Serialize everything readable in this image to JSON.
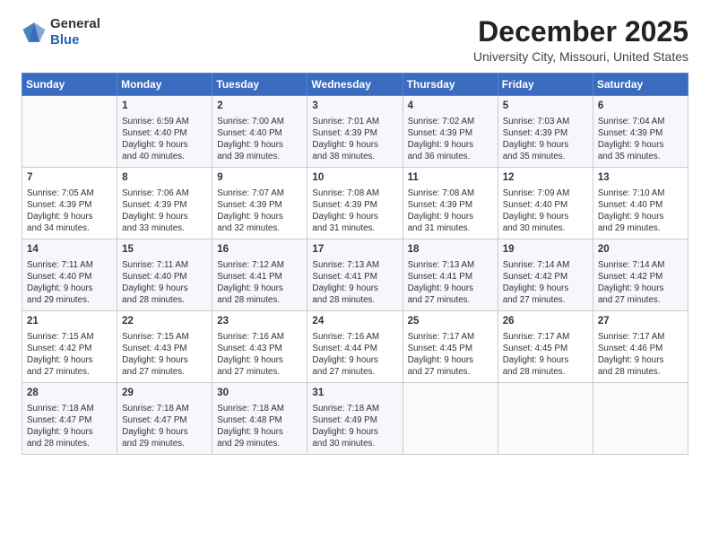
{
  "logo": {
    "general": "General",
    "blue": "Blue"
  },
  "header": {
    "title": "December 2025",
    "subtitle": "University City, Missouri, United States"
  },
  "days_of_week": [
    "Sunday",
    "Monday",
    "Tuesday",
    "Wednesday",
    "Thursday",
    "Friday",
    "Saturday"
  ],
  "weeks": [
    [
      {
        "num": "",
        "info": ""
      },
      {
        "num": "1",
        "info": "Sunrise: 6:59 AM\nSunset: 4:40 PM\nDaylight: 9 hours\nand 40 minutes."
      },
      {
        "num": "2",
        "info": "Sunrise: 7:00 AM\nSunset: 4:40 PM\nDaylight: 9 hours\nand 39 minutes."
      },
      {
        "num": "3",
        "info": "Sunrise: 7:01 AM\nSunset: 4:39 PM\nDaylight: 9 hours\nand 38 minutes."
      },
      {
        "num": "4",
        "info": "Sunrise: 7:02 AM\nSunset: 4:39 PM\nDaylight: 9 hours\nand 36 minutes."
      },
      {
        "num": "5",
        "info": "Sunrise: 7:03 AM\nSunset: 4:39 PM\nDaylight: 9 hours\nand 35 minutes."
      },
      {
        "num": "6",
        "info": "Sunrise: 7:04 AM\nSunset: 4:39 PM\nDaylight: 9 hours\nand 35 minutes."
      }
    ],
    [
      {
        "num": "7",
        "info": "Sunrise: 7:05 AM\nSunset: 4:39 PM\nDaylight: 9 hours\nand 34 minutes."
      },
      {
        "num": "8",
        "info": "Sunrise: 7:06 AM\nSunset: 4:39 PM\nDaylight: 9 hours\nand 33 minutes."
      },
      {
        "num": "9",
        "info": "Sunrise: 7:07 AM\nSunset: 4:39 PM\nDaylight: 9 hours\nand 32 minutes."
      },
      {
        "num": "10",
        "info": "Sunrise: 7:08 AM\nSunset: 4:39 PM\nDaylight: 9 hours\nand 31 minutes."
      },
      {
        "num": "11",
        "info": "Sunrise: 7:08 AM\nSunset: 4:39 PM\nDaylight: 9 hours\nand 31 minutes."
      },
      {
        "num": "12",
        "info": "Sunrise: 7:09 AM\nSunset: 4:40 PM\nDaylight: 9 hours\nand 30 minutes."
      },
      {
        "num": "13",
        "info": "Sunrise: 7:10 AM\nSunset: 4:40 PM\nDaylight: 9 hours\nand 29 minutes."
      }
    ],
    [
      {
        "num": "14",
        "info": "Sunrise: 7:11 AM\nSunset: 4:40 PM\nDaylight: 9 hours\nand 29 minutes."
      },
      {
        "num": "15",
        "info": "Sunrise: 7:11 AM\nSunset: 4:40 PM\nDaylight: 9 hours\nand 28 minutes."
      },
      {
        "num": "16",
        "info": "Sunrise: 7:12 AM\nSunset: 4:41 PM\nDaylight: 9 hours\nand 28 minutes."
      },
      {
        "num": "17",
        "info": "Sunrise: 7:13 AM\nSunset: 4:41 PM\nDaylight: 9 hours\nand 28 minutes."
      },
      {
        "num": "18",
        "info": "Sunrise: 7:13 AM\nSunset: 4:41 PM\nDaylight: 9 hours\nand 27 minutes."
      },
      {
        "num": "19",
        "info": "Sunrise: 7:14 AM\nSunset: 4:42 PM\nDaylight: 9 hours\nand 27 minutes."
      },
      {
        "num": "20",
        "info": "Sunrise: 7:14 AM\nSunset: 4:42 PM\nDaylight: 9 hours\nand 27 minutes."
      }
    ],
    [
      {
        "num": "21",
        "info": "Sunrise: 7:15 AM\nSunset: 4:42 PM\nDaylight: 9 hours\nand 27 minutes."
      },
      {
        "num": "22",
        "info": "Sunrise: 7:15 AM\nSunset: 4:43 PM\nDaylight: 9 hours\nand 27 minutes."
      },
      {
        "num": "23",
        "info": "Sunrise: 7:16 AM\nSunset: 4:43 PM\nDaylight: 9 hours\nand 27 minutes."
      },
      {
        "num": "24",
        "info": "Sunrise: 7:16 AM\nSunset: 4:44 PM\nDaylight: 9 hours\nand 27 minutes."
      },
      {
        "num": "25",
        "info": "Sunrise: 7:17 AM\nSunset: 4:45 PM\nDaylight: 9 hours\nand 27 minutes."
      },
      {
        "num": "26",
        "info": "Sunrise: 7:17 AM\nSunset: 4:45 PM\nDaylight: 9 hours\nand 28 minutes."
      },
      {
        "num": "27",
        "info": "Sunrise: 7:17 AM\nSunset: 4:46 PM\nDaylight: 9 hours\nand 28 minutes."
      }
    ],
    [
      {
        "num": "28",
        "info": "Sunrise: 7:18 AM\nSunset: 4:47 PM\nDaylight: 9 hours\nand 28 minutes."
      },
      {
        "num": "29",
        "info": "Sunrise: 7:18 AM\nSunset: 4:47 PM\nDaylight: 9 hours\nand 29 minutes."
      },
      {
        "num": "30",
        "info": "Sunrise: 7:18 AM\nSunset: 4:48 PM\nDaylight: 9 hours\nand 29 minutes."
      },
      {
        "num": "31",
        "info": "Sunrise: 7:18 AM\nSunset: 4:49 PM\nDaylight: 9 hours\nand 30 minutes."
      },
      {
        "num": "",
        "info": ""
      },
      {
        "num": "",
        "info": ""
      },
      {
        "num": "",
        "info": ""
      }
    ]
  ]
}
